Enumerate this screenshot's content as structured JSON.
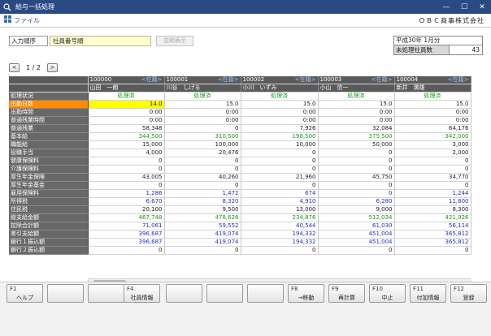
{
  "window": {
    "title": "給与一括処理",
    "minimize": "—",
    "maximize": "☐",
    "close": "✕"
  },
  "menu": {
    "file": "ファイル",
    "company": "ＯＢＣ商事株式会社"
  },
  "order": {
    "label": "入力順序",
    "value": "社員番号順",
    "button": "並順表示"
  },
  "period": "平成30年 1月分",
  "unprocessed": {
    "label": "未処理社員数",
    "value": "43"
  },
  "pager": {
    "prev": "<",
    "next": ">",
    "text": "1 / 2"
  },
  "employees": [
    {
      "code": "100000",
      "status": "<在籍>",
      "name": "山田　一朗"
    },
    {
      "code": "100001",
      "status": "<在籍>",
      "name": "川谷　しげる"
    },
    {
      "code": "100002",
      "status": "<在籍>",
      "name": "小川　いずみ"
    },
    {
      "code": "100003",
      "status": "<在籍>",
      "name": "小山　信一"
    },
    {
      "code": "100004",
      "status": "<在籍>",
      "name": "新井　満雄"
    }
  ],
  "processing": {
    "label": "処理状況",
    "values": [
      "処理済",
      "処理済",
      "処理済",
      "処理済",
      "処理済"
    ]
  },
  "rows": [
    {
      "label": "出勤日数",
      "values": [
        "14.0",
        "15.0",
        "15.0",
        "15.0",
        "15.0"
      ]
    },
    {
      "label": "出勤時間",
      "values": [
        "0:00",
        "0:00",
        "0:00",
        "0:00",
        "0:00"
      ]
    },
    {
      "label": "普通残業時間",
      "values": [
        "0:00",
        "0:00",
        "0:00",
        "0:00",
        "0:00"
      ]
    },
    {
      "label": "普通残業",
      "values": [
        "58,348",
        "0",
        "7,926",
        "32,084",
        "64,176"
      ]
    },
    {
      "label": "基本給",
      "values": [
        "344,500",
        "310,500",
        "198,500",
        "375,500",
        "342,000"
      ]
    },
    {
      "label": "職能給",
      "values": [
        "15,000",
        "100,000",
        "10,000",
        "50,000",
        "3,000"
      ]
    },
    {
      "label": "役職手当",
      "values": [
        "4,000",
        "20,476",
        "0",
        "0",
        "2,000"
      ]
    },
    {
      "label": "健康保険料",
      "values": [
        "0",
        "0",
        "0",
        "0",
        "0"
      ]
    },
    {
      "label": "介護保険料",
      "values": [
        "0",
        "0",
        "0",
        "0",
        "0"
      ]
    },
    {
      "label": "厚生年金保険",
      "values": [
        "43,005",
        "40,260",
        "21,960",
        "45,750",
        "34,770"
      ]
    },
    {
      "label": "厚生年金基金",
      "values": [
        "0",
        "0",
        "0",
        "0",
        "0"
      ]
    },
    {
      "label": "雇用保険料",
      "values": [
        "1,286",
        "1,472",
        "674",
        "0",
        "1,244"
      ]
    },
    {
      "label": "所得税",
      "values": [
        "6,670",
        "8,320",
        "4,910",
        "6,280",
        "11,800"
      ]
    },
    {
      "label": "住民税",
      "values": [
        "20,100",
        "9,500",
        "13,000",
        "9,000",
        "8,300"
      ]
    },
    {
      "label": "総支給金額",
      "values": [
        "467,748",
        "478,626",
        "234,876",
        "512,034",
        "421,926"
      ]
    },
    {
      "label": "控除合計額",
      "values": [
        "71,061",
        "59,552",
        "40,544",
        "61,030",
        "56,114"
      ]
    },
    {
      "label": "差引支給額",
      "values": [
        "396,687",
        "419,074",
        "194,332",
        "451,004",
        "365,812"
      ]
    },
    {
      "label": "銀行１振込額",
      "values": [
        "396,687",
        "419,074",
        "194,332",
        "451,004",
        "365,812"
      ]
    },
    {
      "label": "銀行２振込額",
      "values": [
        "0",
        "0",
        "0",
        "0",
        "0"
      ]
    }
  ],
  "fkeys": [
    {
      "key": "F1",
      "label": "ヘルプ"
    },
    {
      "key": "",
      "label": ""
    },
    {
      "key": "",
      "label": ""
    },
    {
      "key": "F4",
      "label": "社員情報"
    },
    {
      "key": "",
      "label": ""
    },
    {
      "key": "",
      "label": ""
    },
    {
      "key": "",
      "label": ""
    },
    {
      "key": "F8",
      "label": "→移動"
    },
    {
      "key": "F9",
      "label": "再計算"
    },
    {
      "key": "F10",
      "label": "中止"
    },
    {
      "key": "F11",
      "label": "付加情報"
    },
    {
      "key": "F12",
      "label": "登録"
    }
  ]
}
